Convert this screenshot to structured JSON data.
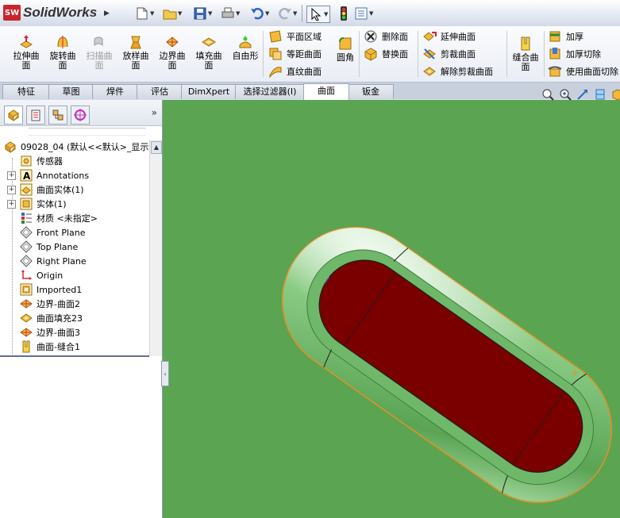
{
  "app": {
    "logo_badge": "SW",
    "brand": "SolidWorks"
  },
  "quick_access": [
    "new-icon",
    "open-icon",
    "save-icon",
    "print-icon",
    "undo-icon",
    "redo-icon",
    "select-icon",
    "traffic-light-icon",
    "options-icon"
  ],
  "ribbon": {
    "big_buttons": [
      {
        "label": "拉伸曲面",
        "icon": "extrude-surface-icon",
        "enabled": true
      },
      {
        "label": "旋转曲面",
        "icon": "revolve-surface-icon",
        "enabled": true
      },
      {
        "label": "扫描曲面",
        "icon": "sweep-surface-icon",
        "enabled": false
      },
      {
        "label": "放样曲面",
        "icon": "loft-surface-icon",
        "enabled": true
      },
      {
        "label": "边界曲面",
        "icon": "boundary-surface-icon",
        "enabled": true
      },
      {
        "label": "填充曲面",
        "icon": "fill-surface-icon",
        "enabled": true
      },
      {
        "label": "自由形",
        "icon": "freeform-icon",
        "enabled": true
      }
    ],
    "group1": [
      {
        "label": "平面区域",
        "icon": "planar-surface-icon"
      },
      {
        "label": "等距曲面",
        "icon": "offset-surface-icon"
      },
      {
        "label": "直纹曲面",
        "icon": "ruled-surface-icon"
      }
    ],
    "fillet": {
      "label": "圆角",
      "icon": "fillet-icon"
    },
    "group2": [
      {
        "label": "删除面",
        "icon": "delete-face-icon"
      },
      {
        "label": "替换面",
        "icon": "replace-face-icon"
      }
    ],
    "group3": [
      {
        "label": "延伸曲面",
        "icon": "extend-surface-icon"
      },
      {
        "label": "剪裁曲面",
        "icon": "trim-surface-icon"
      },
      {
        "label": "解除剪裁曲面",
        "icon": "untrim-surface-icon"
      }
    ],
    "knit": {
      "label": "缝合曲面",
      "icon": "knit-surface-icon"
    },
    "group4": [
      {
        "label": "加厚",
        "icon": "thicken-icon"
      },
      {
        "label": "加厚切除",
        "icon": "thicken-cut-icon"
      },
      {
        "label": "使用曲面切除",
        "icon": "surface-cut-icon"
      }
    ]
  },
  "tabs": [
    {
      "label": "特征",
      "active": false
    },
    {
      "label": "草图",
      "active": false
    },
    {
      "label": "焊件",
      "active": false
    },
    {
      "label": "评估",
      "active": false
    },
    {
      "label": "DimXpert",
      "active": false
    },
    {
      "label": "选择过滤器(I)",
      "active": false
    },
    {
      "label": "曲面",
      "active": true
    },
    {
      "label": "钣金",
      "active": false
    }
  ],
  "panel_tabs": [
    "feature-manager-icon",
    "property-manager-icon",
    "configuration-manager-icon",
    "dimxpert-manager-icon"
  ],
  "tree": [
    {
      "label": "09028_04  (默认<<默认>_显示",
      "icon": "part-icon",
      "expandable": false,
      "root": true
    },
    {
      "label": "传感器",
      "icon": "sensor-icon",
      "expandable": false
    },
    {
      "label": "Annotations",
      "icon": "annotations-icon",
      "expandable": true
    },
    {
      "label": "曲面实体(1)",
      "icon": "surface-bodies-icon",
      "expandable": true
    },
    {
      "label": "实体(1)",
      "icon": "solid-bodies-icon",
      "expandable": true
    },
    {
      "label": "材质 <未指定>",
      "icon": "material-icon",
      "expandable": false
    },
    {
      "label": "Front Plane",
      "icon": "plane-icon",
      "expandable": false
    },
    {
      "label": "Top Plane",
      "icon": "plane-icon",
      "expandable": false
    },
    {
      "label": "Right Plane",
      "icon": "plane-icon",
      "expandable": false
    },
    {
      "label": "Origin",
      "icon": "origin-icon",
      "expandable": false
    },
    {
      "label": "Imported1",
      "icon": "imported-icon",
      "expandable": false
    },
    {
      "label": "边界-曲面2",
      "icon": "boundary-surface-icon",
      "expandable": false
    },
    {
      "label": "曲面填充23",
      "icon": "fill-surface-icon",
      "expandable": false
    },
    {
      "label": "边界-曲面3",
      "icon": "boundary-surface-icon",
      "expandable": false
    },
    {
      "label": "曲面-缝合1",
      "icon": "knit-surface-icon",
      "expandable": false
    }
  ],
  "view_tools": [
    "zoom-to-fit-icon",
    "zoom-area-icon",
    "previous-view-icon",
    "section-view-icon",
    "view-orientation-icon"
  ],
  "colors": {
    "viewport_bg": "#5ba452",
    "surface_light": "#d9f3d6",
    "surface_mid": "#8fd08a",
    "surface_dark": "#4f9a4a",
    "inner_face": "#7a0000",
    "outline": "#e0902a"
  }
}
